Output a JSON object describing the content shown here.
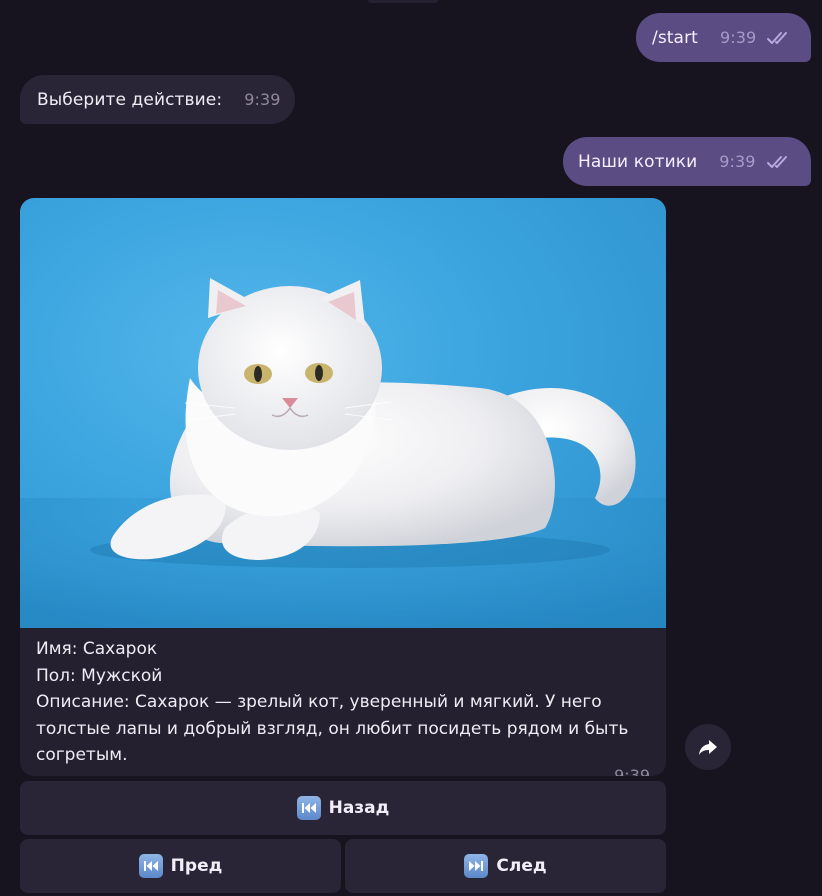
{
  "messages": [
    {
      "text": "/start",
      "time": "9:39",
      "direction": "outgoing",
      "status": "read"
    },
    {
      "text": "Выберите действие:",
      "time": "9:39",
      "direction": "incoming"
    },
    {
      "text": "Наши котики",
      "time": "9:39",
      "direction": "outgoing",
      "status": "read"
    }
  ],
  "photo_message": {
    "image": "white-cat-photo",
    "caption_lines": [
      "Имя: Сахарок",
      "Пол: Мужской",
      "Описание: Сахарок — зрелый кот, уверенный и мягкий. У него",
      "толстые лапы и добрый взгляд, он любит посидеть рядом и быть",
      "согретым."
    ],
    "time": "9:39"
  },
  "share_button": {
    "icon": "share-arrow-icon"
  },
  "inline_keyboard": {
    "back": {
      "label": "Назад",
      "icon": "rewind-icon"
    },
    "prev": {
      "label": "Пред",
      "icon": "rewind-icon"
    },
    "next": {
      "label": "След",
      "icon": "fast-forward-icon"
    }
  },
  "colors": {
    "background": "#18141f",
    "outgoing_bubble": "#5b4c83",
    "incoming_bubble": "#2a2536",
    "photo_background": "#3aa3de"
  }
}
